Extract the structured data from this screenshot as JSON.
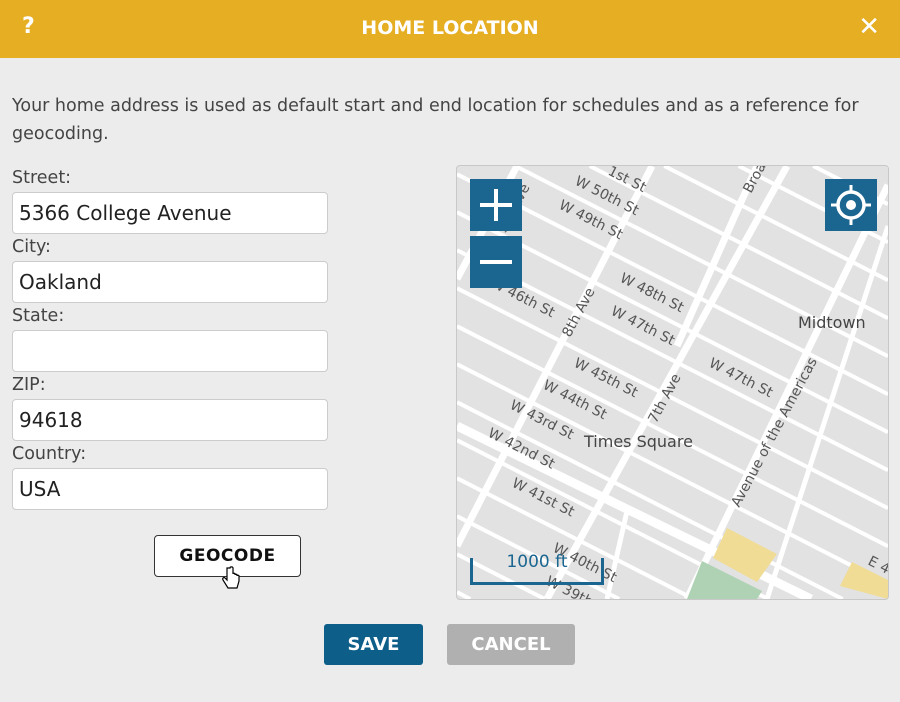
{
  "dialog": {
    "title": "HOME LOCATION",
    "help_label": "?",
    "close_label": "✕",
    "description": "Your home address is used as default start and end location for schedules and as a reference for geocoding."
  },
  "form": {
    "street": {
      "label": "Street:",
      "value": "5366 College Avenue"
    },
    "city": {
      "label": "City:",
      "value": "Oakland"
    },
    "state": {
      "label": "State:",
      "value": ""
    },
    "zip": {
      "label": "ZIP:",
      "value": "94618"
    },
    "country": {
      "label": "Country:",
      "value": "USA"
    },
    "geocode_label": "GEOCODE"
  },
  "map": {
    "zoom_in_icon": "plus-icon",
    "zoom_out_icon": "minus-icon",
    "locate_icon": "crosshair-icon",
    "scale_label": "1000 ft",
    "labels": {
      "w51": "1st St",
      "w50": "W 50th St",
      "w49": "W 49th St",
      "w48": "W 48th St",
      "w47a": "W 47th St",
      "w46": "W 46th St",
      "ave8": "8th Ave",
      "ave9": "9th Ave",
      "w45": "W 45th St",
      "w44": "W 44th St",
      "w43": "W 43rd St",
      "w42": "W 42nd St",
      "w41": "W 41st St",
      "w40": "W 40th St",
      "w39": "W 39th",
      "ave7": "7th Ave",
      "w47b": "W 47th St",
      "avam": "Avenue of the Americas",
      "broadway": "Broa",
      "midtown": "Midtown",
      "times_square": "Times Square",
      "e4": "E 4"
    },
    "colors": {
      "land": "#e2e2e2",
      "road": "#ffffff",
      "park": "#afd2b4",
      "building": "#f0dc94",
      "control": "#1a6690"
    }
  },
  "footer": {
    "save_label": "SAVE",
    "cancel_label": "CANCEL"
  },
  "colors": {
    "header": "#e6ae22",
    "save": "#0d5f8a",
    "cancel": "#b0b0b0"
  }
}
